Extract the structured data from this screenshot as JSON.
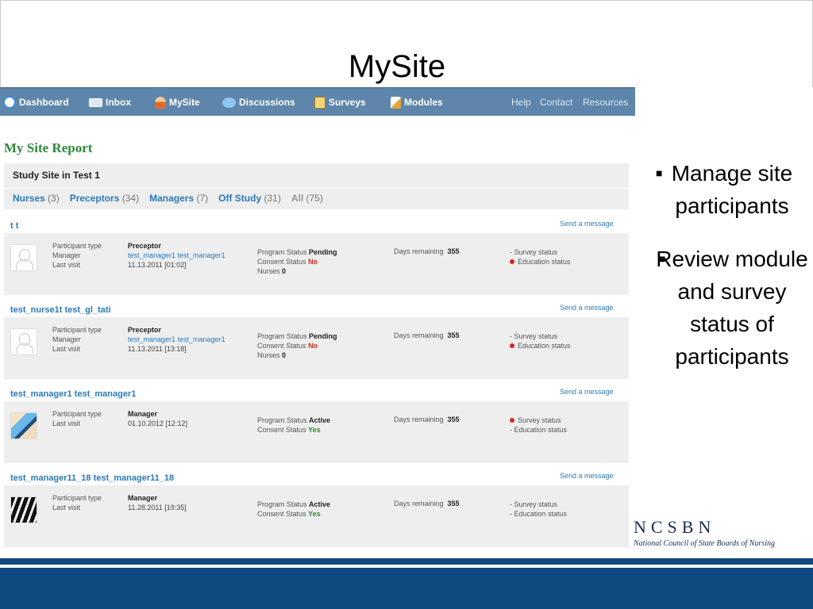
{
  "slide": {
    "title": "MySite",
    "bullets": [
      "Manage site participants",
      "Review module and survey status of participants"
    ],
    "logo": {
      "name": "NCSBN",
      "tagline": "National Council of State Boards of Nursing"
    }
  },
  "nav": {
    "items": [
      {
        "label": "Dashboard",
        "icon": "dashboard-icon"
      },
      {
        "label": "Inbox",
        "icon": "envelope-icon"
      },
      {
        "label": "MySite",
        "icon": "user-icon"
      },
      {
        "label": "Discussions",
        "icon": "chat-bubbles-icon"
      },
      {
        "label": "Surveys",
        "icon": "clipboard-icon"
      },
      {
        "label": "Modules",
        "icon": "pencil-note-icon"
      }
    ],
    "links": [
      "Help",
      "Contact",
      "Resources"
    ]
  },
  "report": {
    "title": "My Site Report",
    "site_name": "Study Site in Test 1",
    "filters": [
      {
        "label": "Nurses",
        "count": "(3)"
      },
      {
        "label": "Preceptors",
        "count": "(34)"
      },
      {
        "label": "Managers",
        "count": "(7)"
      },
      {
        "label": "Off Study",
        "count": "(31)"
      },
      {
        "label": "All",
        "count": "(75)"
      }
    ]
  },
  "labels": {
    "participant_type": "Participant type",
    "manager": "Manager",
    "last_visit": "Last visit",
    "program_status": "Program Status",
    "consent_status": "Consent Status",
    "nurses": "Nurses",
    "days_remaining": "Days remaining",
    "send_message": "Send a message",
    "survey_status": "Survey status",
    "education_status": "Education status"
  },
  "participants": [
    {
      "name": "t t",
      "type": "Preceptor",
      "manager": "test_manager1 test_manager1",
      "last_visit": "11.13.2011 [01:02]",
      "program_status": "Pending",
      "consent_status": "No",
      "nurses": "0",
      "days_remaining": "355",
      "survey_flag": false,
      "education_flag": true
    },
    {
      "name": "test_nurse1t test_gl_tati",
      "type": "Preceptor",
      "manager": "test_manager1 test_manager1",
      "last_visit": "11.13.2011 [13:18]",
      "program_status": "Pending",
      "consent_status": "No",
      "nurses": "0",
      "days_remaining": "355",
      "survey_flag": false,
      "education_flag": true
    },
    {
      "name": "test_manager1 test_manager1",
      "type": "Manager",
      "last_visit": "01.10.2012 [12:12]",
      "program_status": "Active",
      "consent_status": "Yes",
      "days_remaining": "355",
      "survey_flag": true,
      "education_flag": false
    },
    {
      "name": "test_manager11_18 test_manager11_18",
      "type": "Manager",
      "last_visit": "11.28.2011 [19:35]",
      "program_status": "Active",
      "consent_status": "Yes",
      "days_remaining": "355",
      "survey_flag": false,
      "education_flag": false
    }
  ],
  "colors": {
    "nav_bg": "#5e86aa",
    "link": "#2a7ab8",
    "report_title": "#2e8a3c",
    "footer": "#0e4a80",
    "alert_dot": "#e02020"
  }
}
